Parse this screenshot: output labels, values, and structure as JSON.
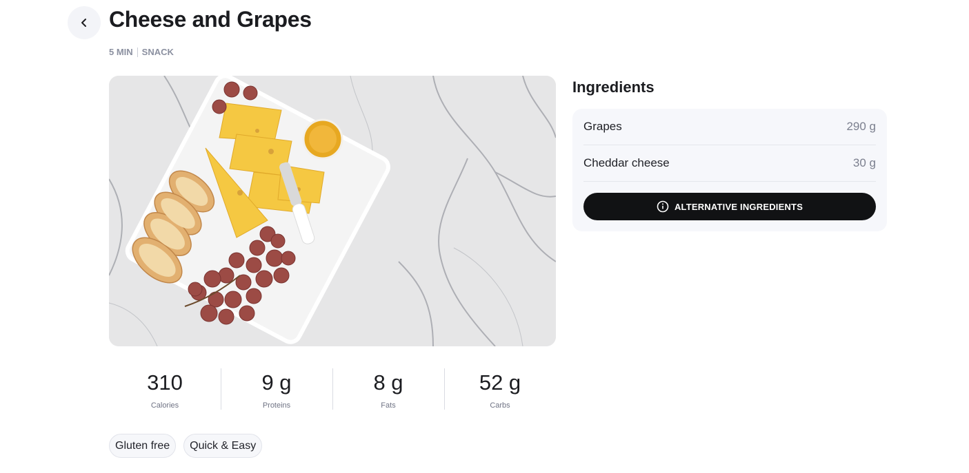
{
  "header": {
    "back_icon": "chevron-left-icon",
    "title": "Cheese and Grapes",
    "time": "5 MIN",
    "category": "SNACK"
  },
  "hero_image": {
    "subject": "photo"
  },
  "nutrition": [
    {
      "value": "310",
      "label": "Calories"
    },
    {
      "value": "9 g",
      "label": "Proteins"
    },
    {
      "value": "8 g",
      "label": "Fats"
    },
    {
      "value": "52 g",
      "label": "Carbs"
    }
  ],
  "tags": [
    "Gluten free",
    "Quick & Easy"
  ],
  "ingredients": {
    "title": "Ingredients",
    "items": [
      {
        "name": "Grapes",
        "quantity": "290 g"
      },
      {
        "name": "Cheddar cheese",
        "quantity": "30 g"
      }
    ],
    "alternative_button": {
      "label": "ALTERNATIVE INGREDIENTS",
      "icon": "info-icon"
    }
  },
  "colors": {
    "button_bg": "#111214",
    "card_bg": "#f6f7fb",
    "meta_text": "#8b90a0"
  }
}
